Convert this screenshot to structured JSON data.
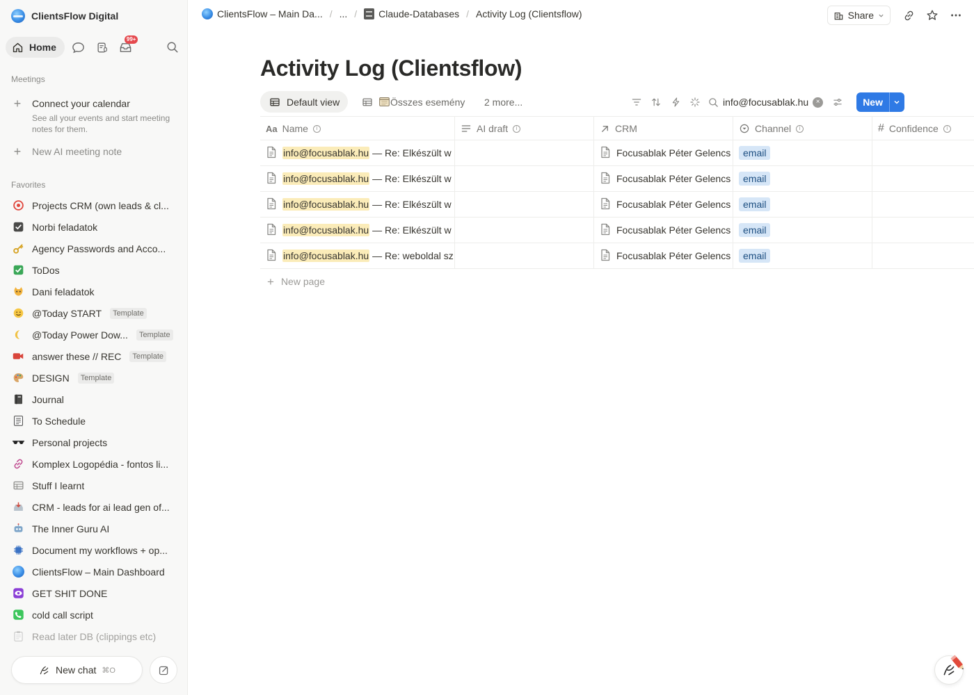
{
  "workspace": {
    "name": "ClientsFlow Digital"
  },
  "topnav": {
    "home_label": "Home",
    "inbox_badge": "99+"
  },
  "meetings": {
    "section_label": "Meetings",
    "connect_title": "Connect your calendar",
    "connect_sub": "See all your events and start meeting notes for them.",
    "new_ai_note": "New AI meeting note"
  },
  "favorites": {
    "section_label": "Favorites",
    "items": [
      {
        "label": "Projects CRM (own leads & cl...",
        "icon": "target-icon"
      },
      {
        "label": "Norbi feladatok",
        "icon": "checkbox-dark-icon"
      },
      {
        "label": "Agency Passwords and Acco...",
        "icon": "key-icon"
      },
      {
        "label": "ToDos",
        "icon": "green-check-icon"
      },
      {
        "label": "Dani feladatok",
        "icon": "cat-icon"
      },
      {
        "label": "@Today START",
        "icon": "smile-face-icon",
        "tag": "Template"
      },
      {
        "label": "@Today Power Dow...",
        "icon": "moon-icon",
        "tag": "Template"
      },
      {
        "label": "answer these // REC",
        "icon": "video-camera-icon",
        "tag": "Template"
      },
      {
        "label": "DESIGN",
        "icon": "palette-icon",
        "tag": "Template"
      },
      {
        "label": "Journal",
        "icon": "notebook-icon"
      },
      {
        "label": "To Schedule",
        "icon": "ledger-icon"
      },
      {
        "label": "Personal projects",
        "icon": "sunglasses-icon"
      },
      {
        "label": "Komplex Logopédia - fontos li...",
        "icon": "link-icon"
      },
      {
        "label": "Stuff I learnt",
        "icon": "table-icon"
      },
      {
        "label": "CRM - leads for ai lead gen of...",
        "icon": "inbox-tray-icon"
      },
      {
        "label": "The Inner Guru AI",
        "icon": "robot-icon"
      },
      {
        "label": "Document my workflows + op...",
        "icon": "chip-icon"
      },
      {
        "label": "ClientsFlow – Main Dashboard",
        "icon": "clientsflow-logo-icon"
      },
      {
        "label": "GET SHIT DONE",
        "icon": "purple-eye-icon"
      },
      {
        "label": "cold call script",
        "icon": "phone-icon"
      },
      {
        "label": "Read later DB (clippings etc)",
        "icon": "clipboard-icon"
      }
    ]
  },
  "bottom": {
    "new_chat": "New chat",
    "shortcut": "⌘O"
  },
  "breadcrumbs": [
    {
      "label": "ClientsFlow – Main Da..."
    },
    {
      "label": "..."
    },
    {
      "label": "Claude-Databases"
    },
    {
      "label": "Activity Log (Clientsflow)"
    }
  ],
  "top_actions": {
    "share": "Share"
  },
  "page": {
    "title": "Activity Log (Clientsflow)"
  },
  "views": {
    "default": "Default view",
    "second": "Összes esemény",
    "more": "2 more..."
  },
  "search": {
    "value": "info@focusablak.hu"
  },
  "new_button": "New",
  "table": {
    "columns": [
      {
        "label": "Name",
        "icon": "aa-text-icon"
      },
      {
        "label": "AI draft",
        "icon": "text-lines-icon"
      },
      {
        "label": "CRM",
        "icon": "relation-arrow-icon"
      },
      {
        "label": "Channel",
        "icon": "select-icon"
      },
      {
        "label": "Confidence",
        "icon": "hash-icon"
      }
    ],
    "rows": [
      {
        "email": "info@focusablak.hu",
        "rest": " — Re: Elkészült w",
        "crm": "Focusablak Péter Gelencs",
        "channel": "email"
      },
      {
        "email": "info@focusablak.hu",
        "rest": " — Re: Elkészült w",
        "crm": "Focusablak Péter Gelencs",
        "channel": "email"
      },
      {
        "email": "info@focusablak.hu",
        "rest": " — Re: Elkészült w",
        "crm": "Focusablak Péter Gelencs",
        "channel": "email"
      },
      {
        "email": "info@focusablak.hu",
        "rest": " — Re: Elkészült w",
        "crm": "Focusablak Péter Gelencs",
        "channel": "email"
      },
      {
        "email": "info@focusablak.hu",
        "rest": " — Re: weboldal sz",
        "crm": "Focusablak Péter Gelencs",
        "channel": "email"
      }
    ],
    "new_page": "New page"
  }
}
